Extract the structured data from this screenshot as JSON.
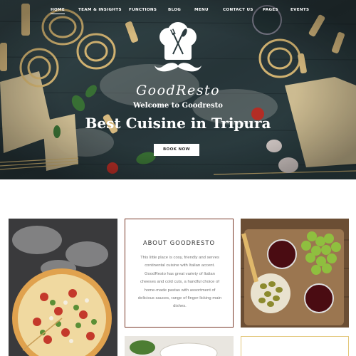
{
  "nav": {
    "items": [
      {
        "label": "HOME",
        "active": true
      },
      {
        "label": "TEAM & INSIGHTS",
        "active": false
      },
      {
        "label": "FUNCTIONS",
        "active": false
      },
      {
        "label": "BLOG",
        "active": false
      },
      {
        "label": "MENU",
        "active": false
      },
      {
        "label": "CONTACT US",
        "active": false
      },
      {
        "label": "PAGES",
        "active": false
      },
      {
        "label": "EVENTS",
        "active": false
      }
    ]
  },
  "hero": {
    "logo_icon": "chef-hat-fork-knife-mustache",
    "brand": "GoodResto",
    "welcome": "Welcome to Goodresto",
    "headline": "Best Cuisine in Tripura",
    "cta_label": "BOOK NOW"
  },
  "about": {
    "title": "ABOUT GOODRESTO",
    "text": "This little place is cosy, friendly and serves continental cuisine with Italian accent. GoodResto has great variety of Italian cheeses and cold cuts, a handful choice of home-made pastas with assortment of delicious sauces, range of finger-licking main dishes."
  },
  "colors": {
    "hero_bg": "#2a3a3e",
    "about_border": "#7a3a2a",
    "white": "#ffffff"
  }
}
